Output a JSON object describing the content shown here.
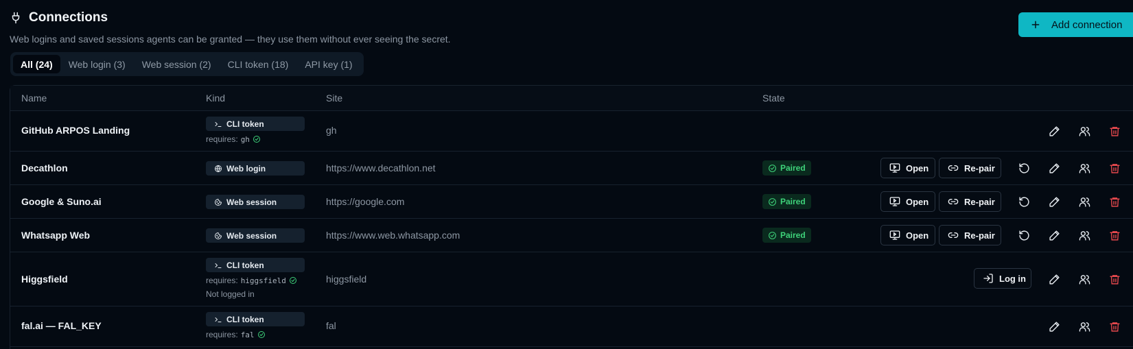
{
  "header": {
    "title": "Connections",
    "subtitle": "Web logins and saved sessions agents can be granted — they use them without ever seeing the secret.",
    "add_button": "Add connection"
  },
  "tabs": [
    {
      "label": "All (24)",
      "active": true
    },
    {
      "label": "Web login (3)",
      "active": false
    },
    {
      "label": "Web session (2)",
      "active": false
    },
    {
      "label": "CLI token (18)",
      "active": false
    },
    {
      "label": "API key (1)",
      "active": false
    }
  ],
  "table": {
    "columns": {
      "name": "Name",
      "kind": "Kind",
      "site": "Site",
      "state": "State"
    },
    "actions": {
      "open": "Open",
      "repair": "Re-pair",
      "login": "Log in"
    },
    "rows": [
      {
        "name": "GitHub ARPOS Landing",
        "kind": "CLI token",
        "requires_label": "requires:",
        "requires": "gh",
        "site": "gh"
      },
      {
        "name": "Decathlon",
        "kind": "Web login",
        "site": "https://www.decathlon.net",
        "state": "Paired"
      },
      {
        "name": "Google & Suno.ai",
        "kind": "Web session",
        "site": "https://google.com",
        "state": "Paired"
      },
      {
        "name": "Whatsapp Web",
        "kind": "Web session",
        "site": "https://www.web.whatsapp.com",
        "state": "Paired"
      },
      {
        "name": "Higgsfield",
        "kind": "CLI token",
        "requires_label": "requires:",
        "requires": "higgsfield",
        "note": "Not logged in",
        "site": "higgsfield"
      },
      {
        "name": "fal.ai — FAL_KEY",
        "kind": "CLI token",
        "requires_label": "requires:",
        "requires": "fal",
        "site": "fal"
      }
    ]
  },
  "colors": {
    "accent": "#0fb7c4",
    "background": "#040a12",
    "paired_green": "#3ed27a",
    "delete_red": "#e5484d"
  },
  "icons": {
    "title": "plug-icon",
    "add": "plus-icon",
    "cli": "terminal-icon",
    "web_login": "globe-icon",
    "web_session": "cookie-icon",
    "check": "check-circle-icon",
    "open": "monitor-play-icon",
    "repair": "link-icon",
    "reset": "rotate-ccw-icon",
    "edit": "pencil-icon",
    "access": "users-icon",
    "delete": "trash-icon",
    "login": "log-in-icon"
  }
}
